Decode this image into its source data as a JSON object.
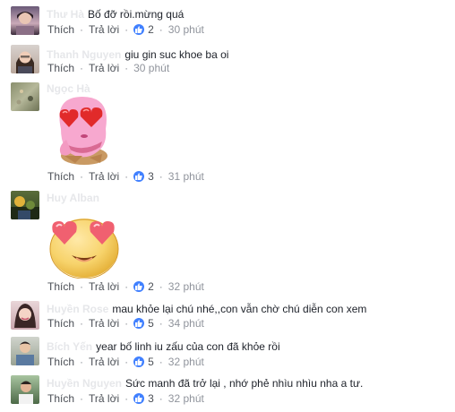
{
  "labels": {
    "like": "Thích",
    "reply": "Trả lời",
    "sep": "·"
  },
  "comments": [
    {
      "author": "Thư Hà",
      "text": "Bố đỡ rồi.mừng quá",
      "likes": "2",
      "time": "30 phút"
    },
    {
      "author": "Thanh Nguyen",
      "text": "giu gin suc khoe ba oi",
      "likes": "",
      "time": "30 phút"
    },
    {
      "author": "Ngọc Hà",
      "text": "",
      "likes": "3",
      "time": "31 phút",
      "sticker": "pink-ice-cream-heart-eyes-sticker"
    },
    {
      "author": "Huy Alban",
      "text": "",
      "likes": "2",
      "time": "32 phút",
      "sticker": "heart-eyes-emoji-sticker"
    },
    {
      "author": "Huyền Rose",
      "text": "mau khỏe lại chú nhé,,con vẫn chờ chú diễn con xem",
      "likes": "5",
      "time": "34 phút"
    },
    {
      "author": "Bích Yến",
      "text": "year bố linh iu zấu của con đã khỏe rồi",
      "likes": "5",
      "time": "32 phút"
    },
    {
      "author": "Huyền Nguyen",
      "text": "Sức manh đã trở lại , nhớ phẻ nhìu nhìu nha a tư.",
      "likes": "3",
      "time": "32 phút"
    }
  ],
  "colors": {
    "like_badge": "#4080ff",
    "action_text": "#4b4f56",
    "time_text": "#90949c"
  }
}
